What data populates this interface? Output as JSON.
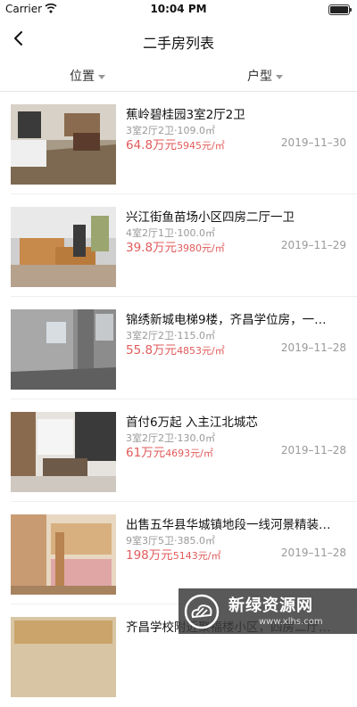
{
  "status_bar": {
    "carrier": "Carrier",
    "time": "10:04 PM"
  },
  "navbar": {
    "title": "二手房列表"
  },
  "filters": [
    {
      "label": "位置"
    },
    {
      "label": "户型"
    }
  ],
  "listings": [
    {
      "title": "蕉岭碧桂园3室2厅2卫",
      "layout": "3室2厅2卫",
      "area": "·109.0㎡",
      "total_price": "64.8万元",
      "unit_price": "5945元/㎡",
      "date": "2019–11–30"
    },
    {
      "title": "兴江街鱼苗场小区四房二厅一卫",
      "layout": "4室2厅1卫",
      "area": "·100.0㎡",
      "total_price": "39.8万元",
      "unit_price": "3980元/㎡",
      "date": "2019–11–29"
    },
    {
      "title": "锦绣新城电梯9楼，齐昌学位房，一…",
      "layout": "3室2厅2卫",
      "area": "·115.0㎡",
      "total_price": "55.8万元",
      "unit_price": "4853元/㎡",
      "date": "2019–11–28"
    },
    {
      "title": "首付6万起 入主江北城芯",
      "layout": "3室2厅2卫",
      "area": "·130.0㎡",
      "total_price": "61万元",
      "unit_price": "4693元/㎡",
      "date": "2019–11–28"
    },
    {
      "title": "出售五华县华城镇地段一线河景精装…",
      "layout": "9室3厅5卫",
      "area": "·385.0㎡",
      "total_price": "198万元",
      "unit_price": "5143元/㎡",
      "date": "2019–11–28"
    },
    {
      "title": "齐昌学校附近聚福楼小区，四房二厅…",
      "layout": "",
      "area": "",
      "total_price": "",
      "unit_price": "",
      "date": ""
    }
  ],
  "watermark": {
    "title": "新绿资源网",
    "url": "www.xlhs.com"
  }
}
